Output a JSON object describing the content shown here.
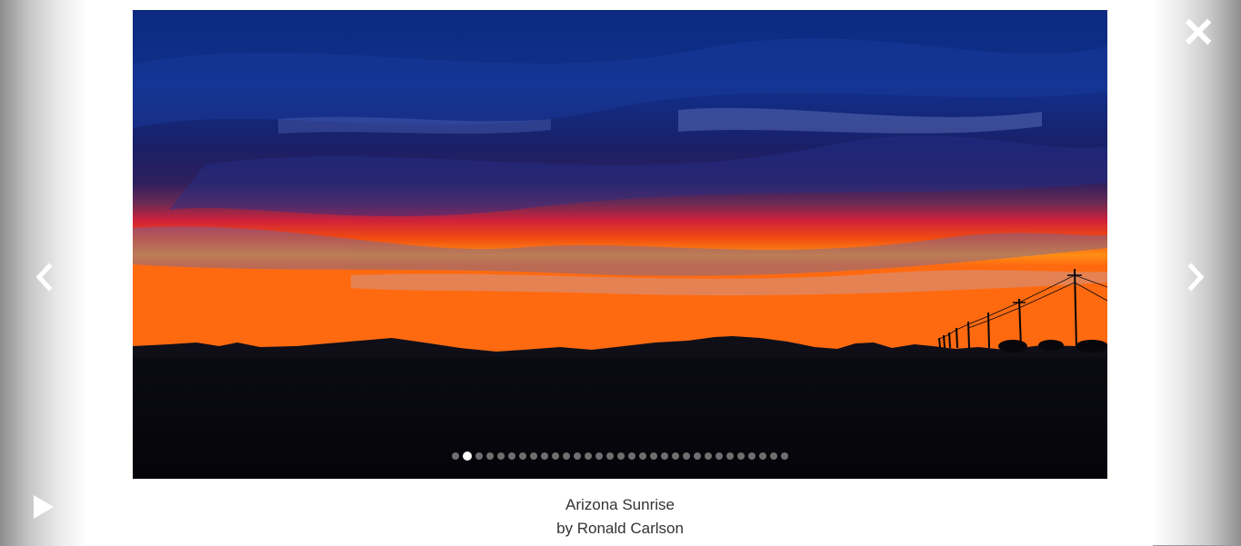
{
  "photo": {
    "title": "Arizona Sunrise",
    "byline": "by Ronald Carlson",
    "alt": "Arizona Sunrise"
  },
  "slideshow": {
    "total_slides": 31,
    "current_index": 2
  },
  "controls": {
    "prev_icon": "chevron-left-icon",
    "next_icon": "chevron-right-icon",
    "close_icon": "close-icon",
    "play_icon": "play-icon"
  },
  "colors": {
    "side_panel_dark": "#8e8e8e",
    "dot_inactive": "#6f6f6f",
    "dot_active": "#ffffff",
    "caption_text": "#333333"
  }
}
